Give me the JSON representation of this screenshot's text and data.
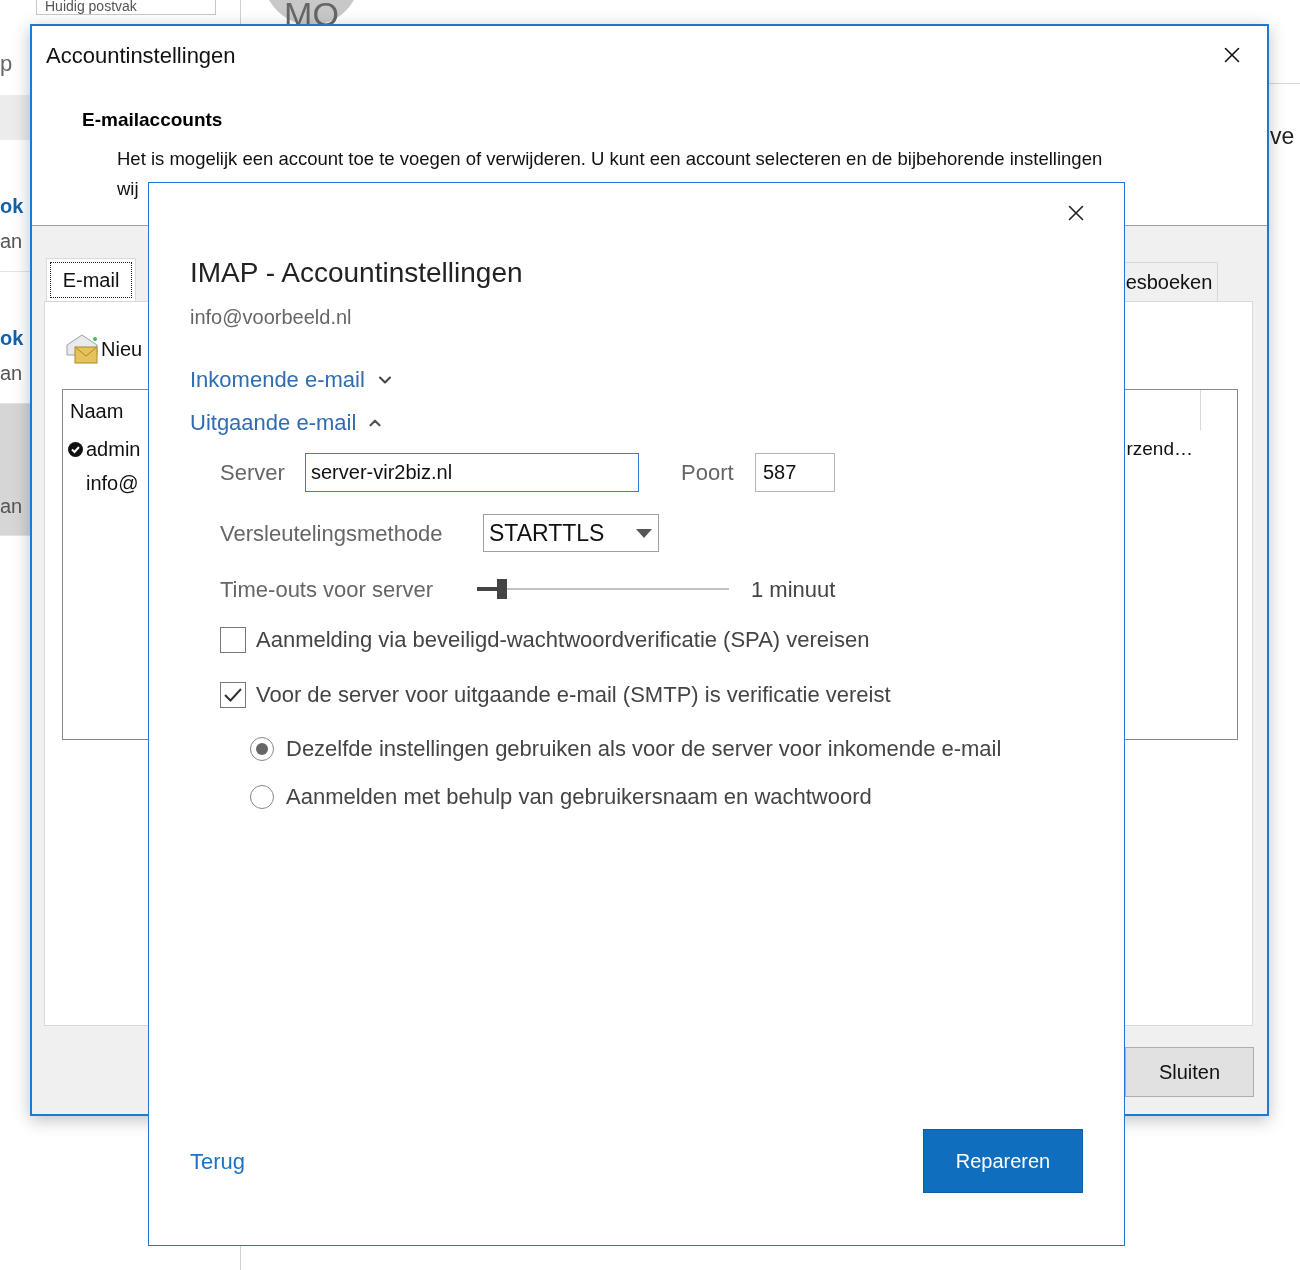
{
  "background": {
    "search_field": {
      "placeholder": "Huidig postvak"
    },
    "avatar": {
      "initials": "MO"
    },
    "sidebar": {
      "top_text": "p",
      "items": [
        {
          "title": "ok",
          "subtitle": "an",
          "selected": false
        },
        {
          "title": "ok",
          "subtitle": "an",
          "selected": false
        },
        {
          "subtitle": "an",
          "selected": true
        }
      ]
    },
    "right_text": "ve"
  },
  "account_settings": {
    "title": "Accountinstellingen",
    "heading": "E-mailaccounts",
    "description": [
      "Het is mogelijk een account toe te voegen of verwijderen. U kunt een account selecteren en de bijbehorende instellingen",
      "wij"
    ],
    "tabs": [
      {
        "label": "E-mail",
        "selected": true
      },
      {
        "label": "esboeken",
        "selected": false
      }
    ],
    "toolbar": {
      "new_label": "Nieu"
    },
    "accounts_list": {
      "columns": [
        "Naam"
      ],
      "rows": [
        {
          "name": "admin",
          "default": true,
          "column_2": "rzend…"
        },
        {
          "name": "info@",
          "default": false
        }
      ]
    },
    "close_button": "Sluiten"
  },
  "imap_dialog": {
    "title": "IMAP - Accountinstellingen",
    "email": "info@voorbeeld.nl",
    "sections": [
      {
        "label": "Inkomende e-mail",
        "expanded": false
      },
      {
        "label": "Uitgaande e-mail",
        "expanded": true
      }
    ],
    "server": {
      "label": "Server",
      "value": "server-vir2biz.nl"
    },
    "port": {
      "label": "Poort",
      "value": "587"
    },
    "encryption": {
      "label": "Versleutelingsmethode",
      "value": "STARTTLS"
    },
    "timeout": {
      "label": "Time-outs voor server",
      "level": 0.1,
      "reading": "1 minuut"
    },
    "checkboxes": [
      {
        "label": "Aanmelding via beveiligd-wachtwoordverificatie (SPA) vereisen",
        "checked": false
      },
      {
        "label": "Voor de server voor uitgaande e-mail (SMTP) is verificatie vereist",
        "checked": true
      }
    ],
    "radios": [
      {
        "label": "Dezelfde instellingen gebruiken als voor de server voor inkomende e-mail",
        "selected": true
      },
      {
        "label": "Aanmelden met behulp van gebruikersnaam en wachtwoord",
        "selected": false
      }
    ],
    "back_link": "Terug",
    "repair_button": "Repareren"
  }
}
